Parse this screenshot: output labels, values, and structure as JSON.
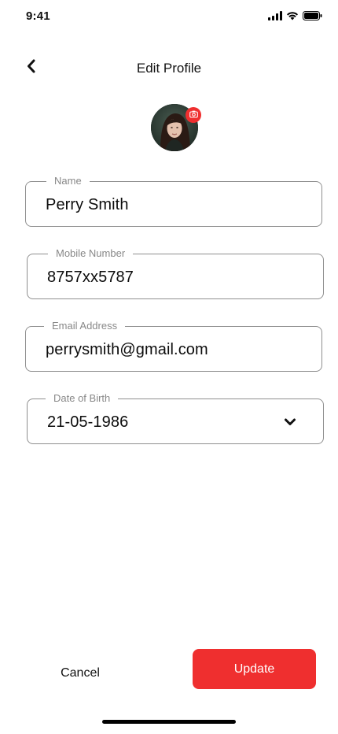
{
  "status_bar": {
    "time": "9:41",
    "icons": [
      "signal-icon",
      "wifi-icon",
      "battery-icon"
    ]
  },
  "header": {
    "back_icon": "chevron-left-icon",
    "title": "Edit Profile"
  },
  "avatar": {
    "badge_icon": "camera-icon",
    "badge_color": "#ef2f2f"
  },
  "form": {
    "name": {
      "label": "Name",
      "value": "Perry Smith"
    },
    "mobile": {
      "label": "Mobile Number",
      "value": "8757xx5787"
    },
    "email": {
      "label": "Email Address",
      "value": "perrysmith@gmail.com"
    },
    "dob": {
      "label": "Date of Birth",
      "value": "21-05-1986",
      "icon": "chevron-down-icon"
    }
  },
  "actions": {
    "cancel_label": "Cancel",
    "update_label": "Update",
    "accent_color": "#ef2f2f"
  }
}
